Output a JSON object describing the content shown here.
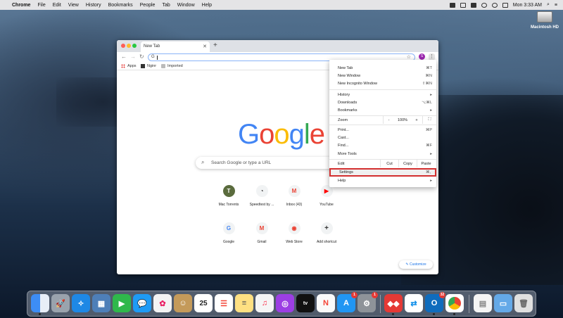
{
  "menubar": {
    "app": "Chrome",
    "items": [
      "File",
      "Edit",
      "View",
      "History",
      "Bookmarks",
      "People",
      "Tab",
      "Window",
      "Help"
    ],
    "clock": "Mon 3:33 AM"
  },
  "desktop": {
    "disk_label": "Macintosh HD"
  },
  "browser": {
    "tab_title": "New Tab",
    "omnibox_value": "G",
    "profile_initial": "S",
    "bookmarks": [
      "Apps",
      "Nginr",
      "Imported"
    ],
    "google_logo": [
      "G",
      "o",
      "o",
      "g",
      "l",
      "e"
    ],
    "search_placeholder": "Search Google or type a URL",
    "shortcuts_row1": [
      {
        "label": "Mac Torrents",
        "glyph": "T",
        "color": "#5a6b3d"
      },
      {
        "label": "Speedtest by ...",
        "glyph": "◔",
        "color": "#333333"
      },
      {
        "label": "Inbox (43)",
        "glyph": "M",
        "color": "#ea4335"
      },
      {
        "label": "YouTube",
        "glyph": "▶",
        "color": "#ff0000"
      }
    ],
    "shortcuts_row2": [
      {
        "label": "Google",
        "glyph": "G",
        "color": "#4285f4"
      },
      {
        "label": "Gmail",
        "glyph": "M",
        "color": "#ea4335"
      },
      {
        "label": "Web Store",
        "glyph": "◉",
        "color": "#ea4335"
      },
      {
        "label": "Add shortcut",
        "glyph": "+",
        "color": "#333333"
      }
    ],
    "customize_label": "Customize"
  },
  "menu": {
    "new_tab": {
      "label": "New Tab",
      "shortcut": "⌘T"
    },
    "new_window": {
      "label": "New Window",
      "shortcut": "⌘N"
    },
    "new_incognito": {
      "label": "New Incognito Window",
      "shortcut": "⇧⌘N"
    },
    "history": {
      "label": "History",
      "arrow": "▸"
    },
    "downloads": {
      "label": "Downloads",
      "shortcut": "⌥⌘L"
    },
    "bookmarks": {
      "label": "Bookmarks",
      "arrow": "▸"
    },
    "zoom": {
      "label": "Zoom",
      "minus": "-",
      "level": "100%",
      "plus": "+",
      "fullscreen": "⛶"
    },
    "print": {
      "label": "Print...",
      "shortcut": "⌘P"
    },
    "cast": {
      "label": "Cast..."
    },
    "find": {
      "label": "Find...",
      "shortcut": "⌘F"
    },
    "more_tools": {
      "label": "More Tools",
      "arrow": "▸"
    },
    "edit": {
      "label": "Edit",
      "cut": "Cut",
      "copy": "Copy",
      "paste": "Paste"
    },
    "settings": {
      "label": "Settings",
      "shortcut": "⌘,"
    },
    "help": {
      "label": "Help",
      "arrow": "▸"
    }
  },
  "dock": {
    "badges": {
      "appstore": "1",
      "settings": "1",
      "outlook": "32"
    },
    "calendar_day": "25"
  },
  "colors": {
    "accent": "#1a73e8",
    "highlight_border": "#d32f2f"
  }
}
